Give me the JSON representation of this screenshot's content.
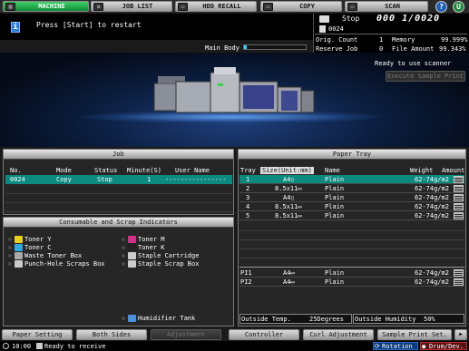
{
  "tabs": [
    {
      "label": "MACHINE",
      "icon": "machine-icon",
      "active": true
    },
    {
      "label": "JOB LIST",
      "icon": "job-list-icon"
    },
    {
      "label": "HDD RECALL",
      "icon": "hdd-icon"
    },
    {
      "label": "COPY",
      "icon": "copy-icon"
    },
    {
      "label": "SCAN",
      "icon": "scan-icon"
    }
  ],
  "top_buttons": {
    "help": "?",
    "utility": "U"
  },
  "message": {
    "icon": "i",
    "text": "Press [Start] to restart",
    "main_body_label": "Main Body"
  },
  "status": {
    "state": "Stop",
    "counter": "000 1/0020",
    "job_id": "0024",
    "orig_count_label": "Orig. Count",
    "orig_count_value": "1",
    "memory_label": "Memory",
    "memory_value": "99.999%",
    "reserve_job_label": "Reserve Job",
    "reserve_job_value": "0",
    "file_amount_label": "File Amount",
    "file_amount_value": "99.343%",
    "ready_scanner": "Ready to use scanner",
    "execute_sample": "Execute Sample Print"
  },
  "job_panel": {
    "title": "Job",
    "columns": [
      "No.",
      "Mode",
      "Status",
      "Minute(S)",
      "User Name"
    ],
    "rows": [
      {
        "no": "0024",
        "mode": "Copy",
        "status": "Stop",
        "minutes": "1",
        "user": "----------------"
      }
    ]
  },
  "consumables": {
    "title": "Consumable and Scrap Indicators",
    "items": [
      {
        "label": "Toner Y",
        "color": "#e8d020"
      },
      {
        "label": "Toner M",
        "color": "#d0308a"
      },
      {
        "label": "Toner C",
        "color": "#30a8e0"
      },
      {
        "label": "Toner K",
        "color": "#222222"
      },
      {
        "label": "Waste Toner Box",
        "color": "#aaaaaa"
      },
      {
        "label": "Staple Cartridge",
        "color": "#cccccc"
      },
      {
        "label": "Punch-Hole Scraps Box",
        "color": "#cccccc"
      },
      {
        "label": "Staple Scrap Box",
        "color": "#cccccc"
      },
      {
        "label": "Humidifier Tank",
        "color": "#4a90e0"
      }
    ]
  },
  "paper_tray": {
    "title": "Paper Tray",
    "columns": [
      "Tray",
      "Size(Unit:mm)",
      "Name",
      "Weight",
      "Amount"
    ],
    "trays": [
      {
        "tray": "1",
        "size": "A4▯",
        "name": "Plain",
        "weight": "62-74g/m2",
        "selected": true
      },
      {
        "tray": "2",
        "size": "8.5x11▭",
        "name": "Plain",
        "weight": "62-74g/m2"
      },
      {
        "tray": "3",
        "size": "A4▯",
        "name": "Plain",
        "weight": "62-74g/m2"
      },
      {
        "tray": "4",
        "size": "8.5x11▭",
        "name": "Plain",
        "weight": "62-74g/m2"
      },
      {
        "tray": "5",
        "size": "8.5x11▭",
        "name": "Plain",
        "weight": "62-74g/m2"
      }
    ],
    "pi_trays": [
      {
        "tray": "PI1",
        "size": "A4▭",
        "name": "Plain",
        "weight": "62-74g/m2"
      },
      {
        "tray": "PI2",
        "size": "A4▭",
        "name": "Plain",
        "weight": "62-74g/m2"
      }
    ],
    "outside_temp_label": "Outside Temp.",
    "outside_temp_value": "25Degrees",
    "outside_humidity_label": "Outside Humidity",
    "outside_humidity_value": "50%"
  },
  "bottom_buttons": [
    "Paper Setting",
    "Both Sides",
    "Adjustment",
    "Controller",
    "Curl Adjustment",
    "Sample Print Set."
  ],
  "statusbar": {
    "time": "10:00",
    "ready": "Ready to receive",
    "rotation": "Rotation",
    "drum": "Drum/Dev."
  }
}
